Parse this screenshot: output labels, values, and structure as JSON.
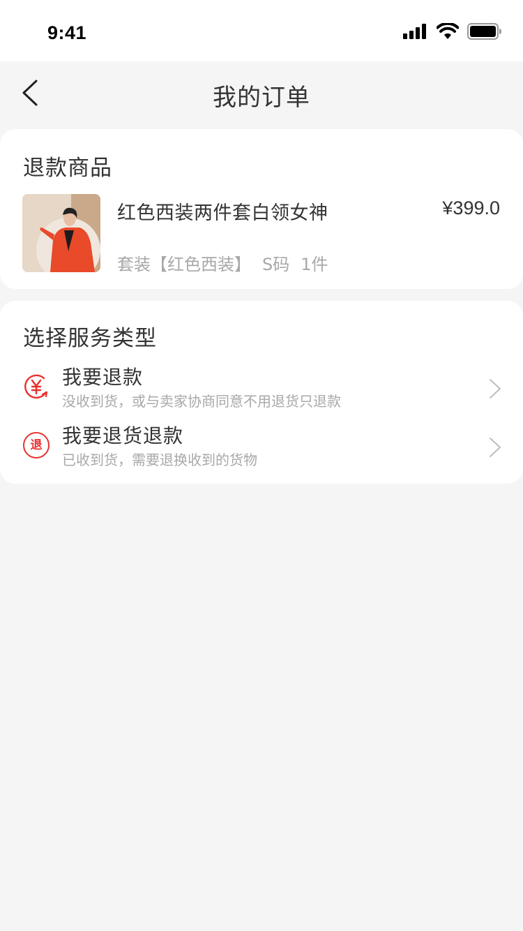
{
  "status_bar": {
    "time": "9:41",
    "icons": [
      "signal-icon",
      "wifi-icon",
      "battery-icon"
    ]
  },
  "nav": {
    "title": "我的订单",
    "back_icon": "chevron-left-icon"
  },
  "refund_card": {
    "title": "退款商品",
    "product": {
      "name": "红色西装两件套白领女神",
      "price": "¥399.0",
      "spec": "套装【红色西装】",
      "size": "S码",
      "quantity": "1件"
    }
  },
  "service_card": {
    "title": "选择服务类型",
    "options": [
      {
        "title": "我要退款",
        "desc": "没收到货，或与卖家协商同意不用退货只退款",
        "icon": "refund-yen-icon"
      },
      {
        "title": "我要退货退款",
        "desc": "已收到货，需要退换收到的货物",
        "icon": "return-icon",
        "icon_text": "退"
      }
    ]
  },
  "colors": {
    "accent": "#e8312f",
    "background": "#f5f5f5",
    "card": "#ffffff",
    "muted_text": "#a8a8a8",
    "primary_text": "#333333"
  }
}
